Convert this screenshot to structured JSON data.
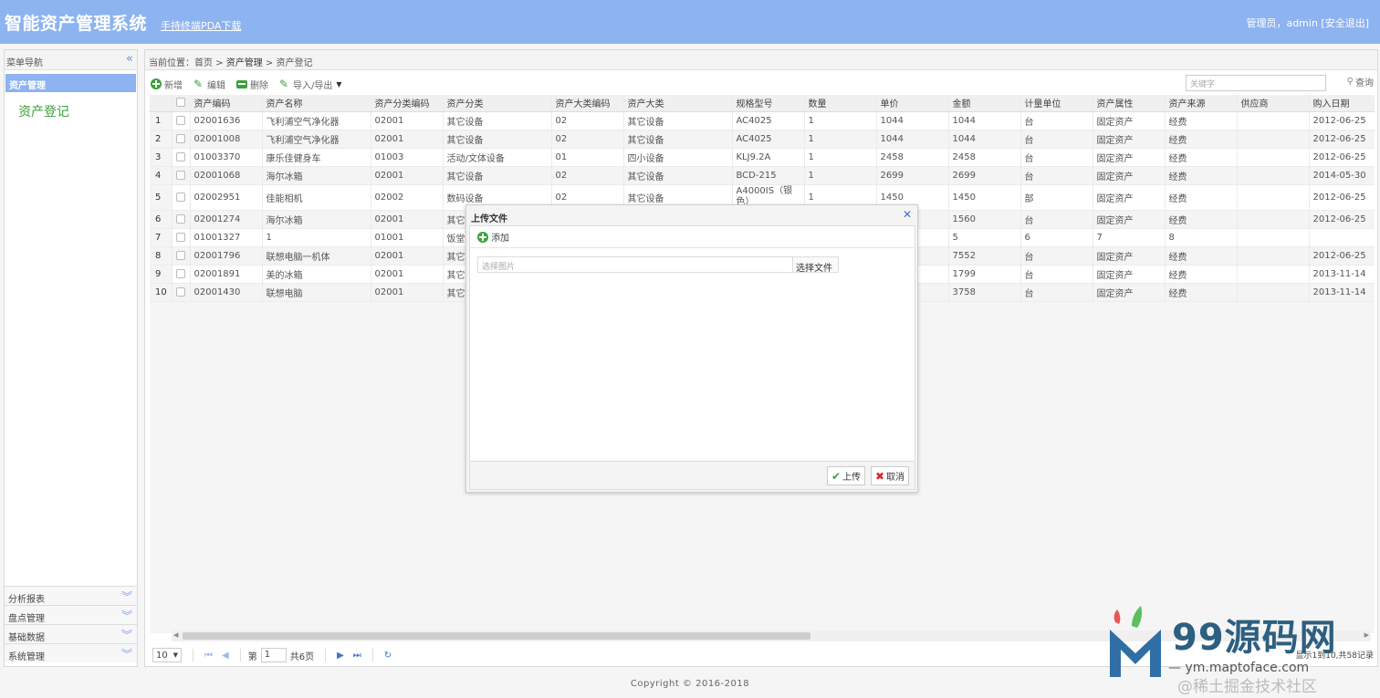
{
  "header": {
    "app_title": "智能资产管理系统",
    "pda_link": "手持终端PDA下载",
    "user_info": "管理员，admin [安全退出]",
    "bg_color": "#8db3f0"
  },
  "sidebar": {
    "title": "菜单导航",
    "collapse_icon": "double-chevron-left-icon",
    "active_group": "资产管理",
    "active_item": "资产登记",
    "sections": [
      {
        "label": "分析报表"
      },
      {
        "label": "盘点管理"
      },
      {
        "label": "基础数据"
      },
      {
        "label": "系统管理"
      }
    ]
  },
  "breadcrumb": {
    "prefix": "当前位置：",
    "home": "首页",
    "sep": " > ",
    "level1": "资产管理",
    "level2": "资产登记"
  },
  "toolbar": {
    "add": "新增",
    "edit": "编辑",
    "delete": "删除",
    "import_export": "导入/导出"
  },
  "search": {
    "placeholder": "关键字",
    "button": "查询"
  },
  "grid": {
    "columns": [
      "资产编码",
      "资产名称",
      "资产分类编码",
      "资产分类",
      "资产大类编码",
      "资产大类",
      "规格型号",
      "数量",
      "单价",
      "金额",
      "计量单位",
      "资产属性",
      "资产来源",
      "供应商",
      "购入日期"
    ],
    "rows": [
      {
        "no": "1",
        "cells": [
          "02001636",
          "飞利浦空气净化器",
          "02001",
          "其它设备",
          "02",
          "其它设备",
          "AC4025",
          "1",
          "1044",
          "1044",
          "台",
          "固定资产",
          "经费",
          "",
          "2012-06-25"
        ]
      },
      {
        "no": "2",
        "cells": [
          "02001008",
          "飞利浦空气净化器",
          "02001",
          "其它设备",
          "02",
          "其它设备",
          "AC4025",
          "1",
          "1044",
          "1044",
          "台",
          "固定资产",
          "经费",
          "",
          "2012-06-25"
        ]
      },
      {
        "no": "3",
        "cells": [
          "01003370",
          "康乐佳健身车",
          "01003",
          "活动/文体设备",
          "01",
          "四小设备",
          "KLJ9.2A",
          "1",
          "2458",
          "2458",
          "台",
          "固定资产",
          "经费",
          "",
          "2012-06-25"
        ]
      },
      {
        "no": "4",
        "cells": [
          "02001068",
          "海尔冰箱",
          "02001",
          "其它设备",
          "02",
          "其它设备",
          "BCD-215",
          "1",
          "2699",
          "2699",
          "台",
          "固定资产",
          "经费",
          "",
          "2014-05-30"
        ]
      },
      {
        "no": "5",
        "cells": [
          "02002951",
          "佳能相机",
          "02002",
          "数码设备",
          "02",
          "其它设备",
          "A4000IS（银色）",
          "1",
          "1450",
          "1450",
          "部",
          "固定资产",
          "经费",
          "",
          "2012-06-25"
        ]
      },
      {
        "no": "6",
        "cells": [
          "02001274",
          "海尔冰箱",
          "02001",
          "其它",
          "",
          "",
          "",
          "",
          "",
          "1560",
          "台",
          "固定资产",
          "经费",
          "",
          "2012-06-25"
        ]
      },
      {
        "no": "7",
        "cells": [
          "01001327",
          "1",
          "01001",
          "饭堂",
          "",
          "",
          "",
          "",
          "",
          "5",
          "6",
          "7",
          "8",
          "",
          ""
        ]
      },
      {
        "no": "8",
        "cells": [
          "02001796",
          "联想电脑一机体",
          "02001",
          "其它",
          "",
          "",
          "",
          "",
          "",
          "7552",
          "台",
          "固定资产",
          "经费",
          "",
          "2012-06-25"
        ]
      },
      {
        "no": "9",
        "cells": [
          "02001891",
          "美的冰箱",
          "02001",
          "其它",
          "",
          "",
          "",
          "",
          "",
          "1799",
          "台",
          "固定资产",
          "经费",
          "",
          "2013-11-14"
        ]
      },
      {
        "no": "10",
        "cells": [
          "02001430",
          "联想电脑",
          "02001",
          "其它",
          "",
          "",
          "",
          "",
          "",
          "3758",
          "台",
          "固定资产",
          "经费",
          "",
          "2013-11-14"
        ]
      }
    ]
  },
  "pager": {
    "page_size": "10",
    "page_prefix": "第",
    "current_page": "1",
    "page_total": "共6页",
    "summary": "显示1到10,共58记录"
  },
  "footer": {
    "copyright": "Copyright © 2016-2018"
  },
  "dialog": {
    "title": "上传文件",
    "add": "添加",
    "file_placeholder": "选择图片",
    "choose_file": "选择文件",
    "upload": "上传",
    "cancel": "取消"
  },
  "watermark": {
    "big": "99源码网",
    "small": "— ym.maptoface.com",
    "extra": "@稀土掘金技术社区"
  }
}
